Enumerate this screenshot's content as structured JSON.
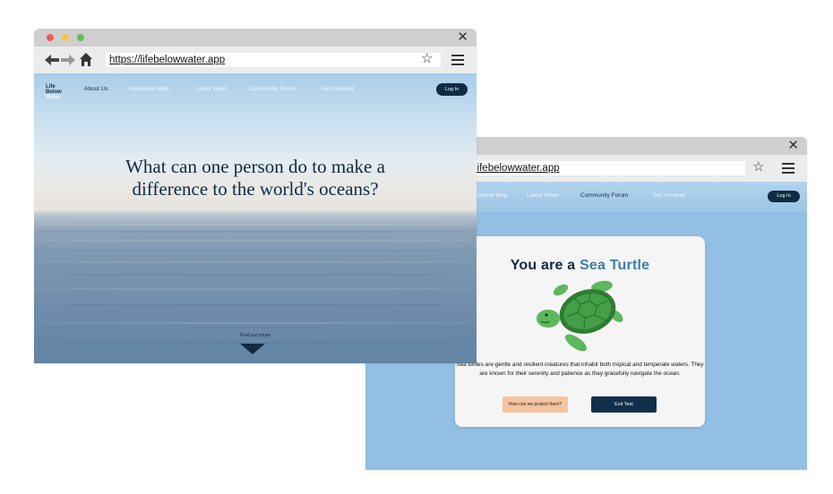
{
  "result_window": {
    "url": "lifebelowwater.app",
    "nav": {
      "items": [
        "Interactive Map",
        "Latest News",
        "Community Forum",
        "Get Involved"
      ],
      "login": "Log In"
    },
    "card": {
      "title_prefix": "You are a",
      "title_accent": "Sea Turtle",
      "description": "Sea turtles are gentle and resilient creatures that inhabit both tropical and temperate waters. They are known for their serenity and patience as they gracefully navigate the ocean.",
      "protect_button": "How can we protect them?",
      "exit_button": "Exit Test"
    },
    "colors": {
      "background": "#92bfe3",
      "accent": "#3d7fa8",
      "dark": "#102f4a",
      "peach": "#f5c3a0"
    }
  },
  "home_window": {
    "url": "https://lifebelowwater.app",
    "logo": [
      "Life",
      "Below",
      "Water"
    ],
    "nav": {
      "items": [
        "About Us",
        "Interactive Map",
        "Latest News",
        "Community Forum",
        "Get Involved"
      ],
      "login": "Log In"
    },
    "hero_line1": "What can one person do to make a",
    "hero_line2": "difference to the world's oceans?",
    "find_out_more": "Find out more"
  },
  "icons": {
    "back": "arrow-left-icon",
    "forward": "arrow-right-icon",
    "home": "home-icon",
    "bookmark": "star-icon",
    "menu": "hamburger-icon",
    "close": "close-icon"
  },
  "window_dots": [
    "#f05b52",
    "#f5bf4f",
    "#5ec153"
  ]
}
